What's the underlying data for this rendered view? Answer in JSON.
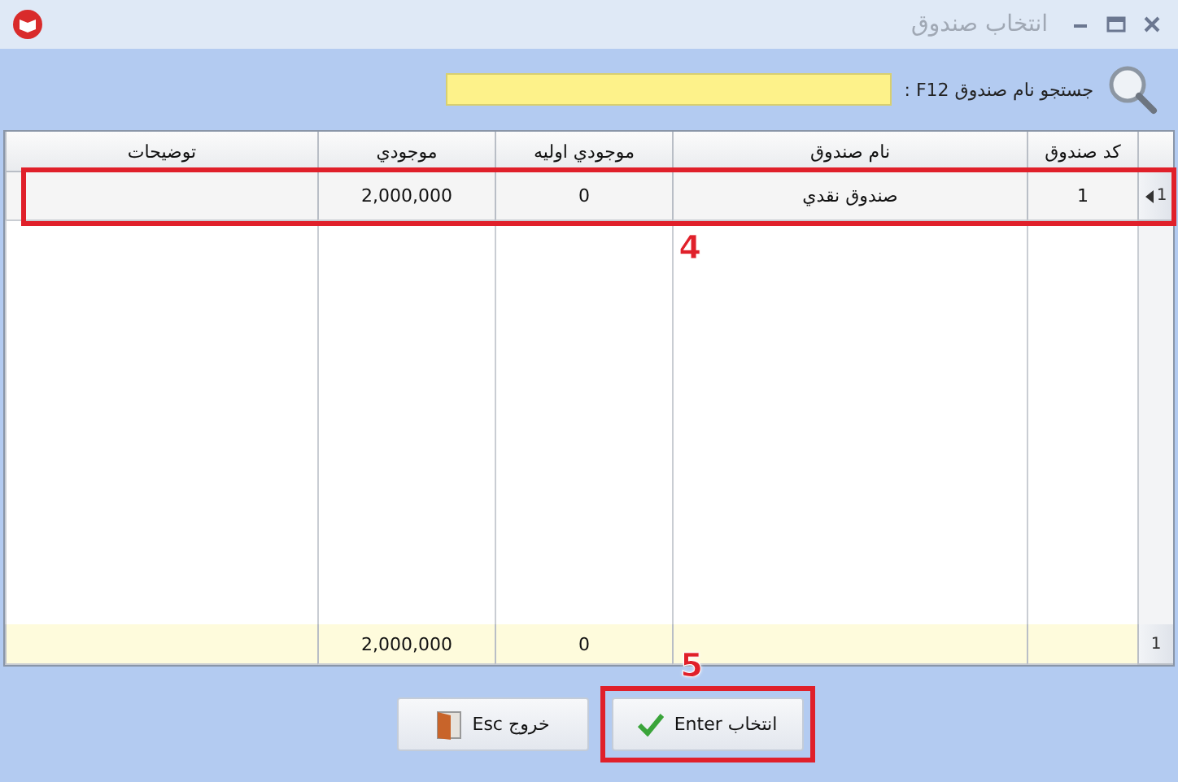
{
  "window": {
    "title": "انتخاب صندوق"
  },
  "search": {
    "label": "جستجو نام صندوق F12 :"
  },
  "table": {
    "columns": [
      "کد صندوق",
      "نام صندوق",
      "موجودي اوليه",
      "موجودي",
      "توضیحات"
    ],
    "rows": [
      {
        "indicator": "1",
        "current": true,
        "highlighted": true,
        "annotation": "4",
        "cells": [
          "1",
          "صندوق نقدي",
          "0",
          "2,000,000",
          ""
        ]
      }
    ],
    "footer": {
      "indicator": "1",
      "cells": [
        "",
        "",
        "0",
        "2,000,000",
        ""
      ]
    }
  },
  "buttons": [
    {
      "kind": "select",
      "label": "انتخاب Enter",
      "highlighted": true,
      "annotation": "5"
    },
    {
      "kind": "exit",
      "label": "خروج Esc"
    }
  ]
}
